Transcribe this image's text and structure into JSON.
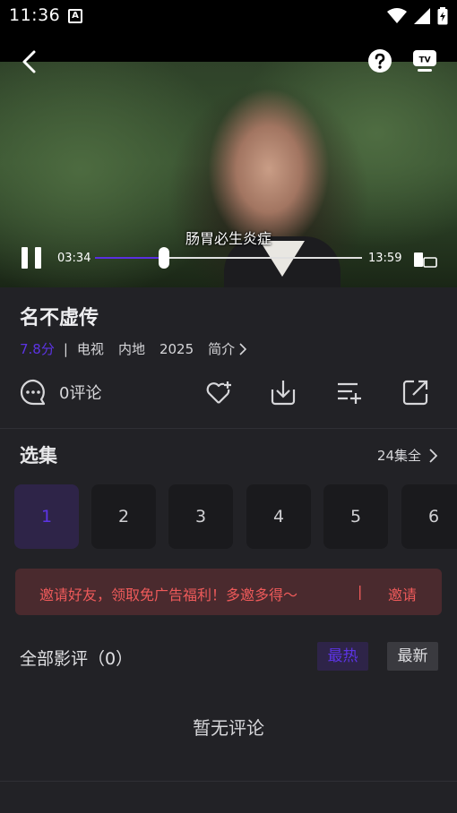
{
  "status": {
    "time": "11:36",
    "a_icon": "A"
  },
  "player": {
    "subtitle": "肠胃必生炎症",
    "current_time": "03:34",
    "total_time": "13:59",
    "progress": 0.26
  },
  "show": {
    "title": "名不虚传",
    "score": "7.8分",
    "separator": "|",
    "type": "电视",
    "region": "内地",
    "year": "2025",
    "intro_label": "简介"
  },
  "actions": {
    "comment_label": "0评论",
    "icons": [
      "comment-icon",
      "favorite-add-icon",
      "download-icon",
      "playlist-add-icon",
      "share-icon"
    ]
  },
  "episodes": {
    "title": "选集",
    "total_label": "24集全",
    "items": [
      "1",
      "2",
      "3",
      "4",
      "5",
      "6"
    ],
    "active": "1"
  },
  "invite": {
    "message": "邀请好友，领取免广告福利！多邀多得～",
    "separator": "|",
    "action": "邀请"
  },
  "reviews": {
    "title": "全部影评（0）",
    "sort_hot": "最热",
    "sort_new": "最新",
    "empty": "暂无评论"
  },
  "colors": {
    "accent": "#5c34e4",
    "background": "#222226",
    "invite_text": "#ee5a5a",
    "invite_bg": "#4a2a2e"
  }
}
